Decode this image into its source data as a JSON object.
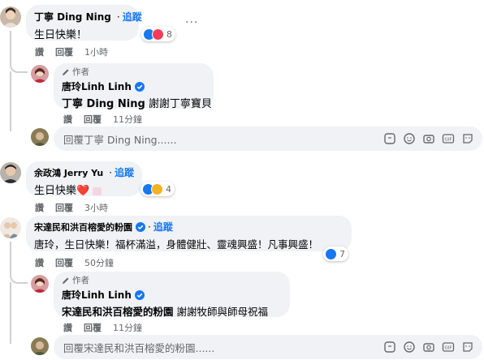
{
  "colors": {
    "link": "#1877f2",
    "meta": "#65676b",
    "bubble": "#f0f2f5",
    "like": "#1877f2",
    "love": "#f33e58",
    "haha": "#f7b125"
  },
  "comments": [
    {
      "name": "丁寧 Ding Ning",
      "follow": "追蹤",
      "text": "生日快樂！",
      "reactions": {
        "count": "8",
        "icons": [
          "like-icon",
          "love-icon"
        ]
      },
      "actions": {
        "like": "讚",
        "reply": "回覆",
        "time": "1小時"
      },
      "reply": {
        "author_tag": "作者",
        "name": "唐玲Linh Linh",
        "mention": "丁寧 Ding Ning",
        "text": "謝謝丁寧寶貝",
        "actions": {
          "like": "讚",
          "reply": "回覆",
          "time": "11分鐘"
        }
      },
      "reply_placeholder": "回覆丁寧 Ding Ning......"
    },
    {
      "name": "余政鴻 Jerry Yu",
      "follow": "追蹤",
      "text": "生日快樂❤️",
      "reactions": {
        "count": "4",
        "icons": [
          "like-icon",
          "care-icon"
        ]
      },
      "actions": {
        "like": "讚",
        "reply": "回覆",
        "time": "3小時"
      }
    },
    {
      "name": "宋達民和洪百榕愛的粉園",
      "follow": "追蹤",
      "text": "唐玲，生日快樂！福杯滿溢，身體健壯、靈魂興盛！凡事興盛！",
      "reactions": {
        "count": "7",
        "icons": [
          "like-icon"
        ]
      },
      "actions": {
        "like": "讚",
        "reply": "回覆",
        "time": "50分鐘"
      },
      "reply": {
        "author_tag": "作者",
        "name": "唐玲Linh Linh",
        "mention": "宋達民和洪百榕愛的粉園",
        "text": "謝謝牧師與師母祝福",
        "actions": {
          "like": "讚",
          "reply": "回覆",
          "time": "11分鐘"
        }
      },
      "reply_placeholder": "回覆宋達民和洪百榕愛的粉園......"
    }
  ],
  "reply_tools": [
    "sticker-icon",
    "emoji-icon",
    "camera-icon",
    "gif-icon",
    "sticker-face-icon"
  ]
}
